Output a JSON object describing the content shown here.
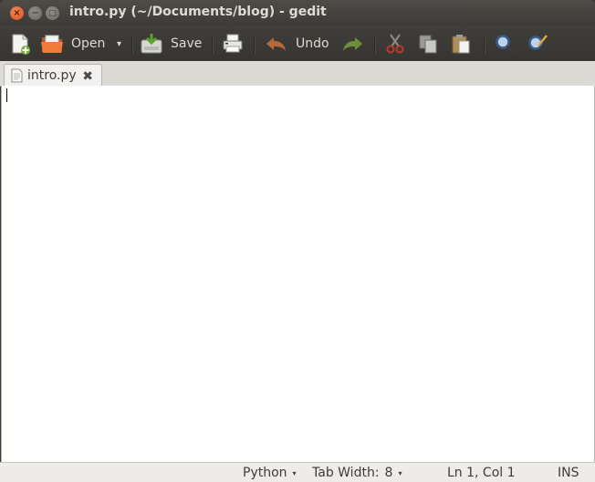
{
  "window": {
    "title": "intro.py (~/Documents/blog) - gedit",
    "close_glyph": "×",
    "minimize_glyph": "−",
    "maximize_glyph": "□"
  },
  "toolbar": {
    "new_icon": "new-document-icon",
    "open_label": "Open",
    "open_dropdown_glyph": "▾",
    "save_label": "Save",
    "print_icon": "print-icon",
    "undo_label": "Undo",
    "redo_icon": "redo-icon",
    "cut_icon": "cut-icon",
    "copy_icon": "copy-icon",
    "paste_icon": "paste-icon",
    "find_icon": "find-icon",
    "replace_icon": "find-replace-icon"
  },
  "tabs": [
    {
      "label": "intro.py",
      "close_glyph": "✖",
      "active": true
    }
  ],
  "editor": {
    "content": ""
  },
  "statusbar": {
    "language": "Python",
    "tab_width_label": "Tab Width:",
    "tab_width_value": "8",
    "position": "Ln 1, Col 1",
    "mode": "INS",
    "dropdown_glyph": "▾"
  },
  "colors": {
    "titlebar": "#3c3b37",
    "close_button": "#dd4a1a",
    "editor_background": "#ffffff",
    "statusbar": "#edece9"
  }
}
